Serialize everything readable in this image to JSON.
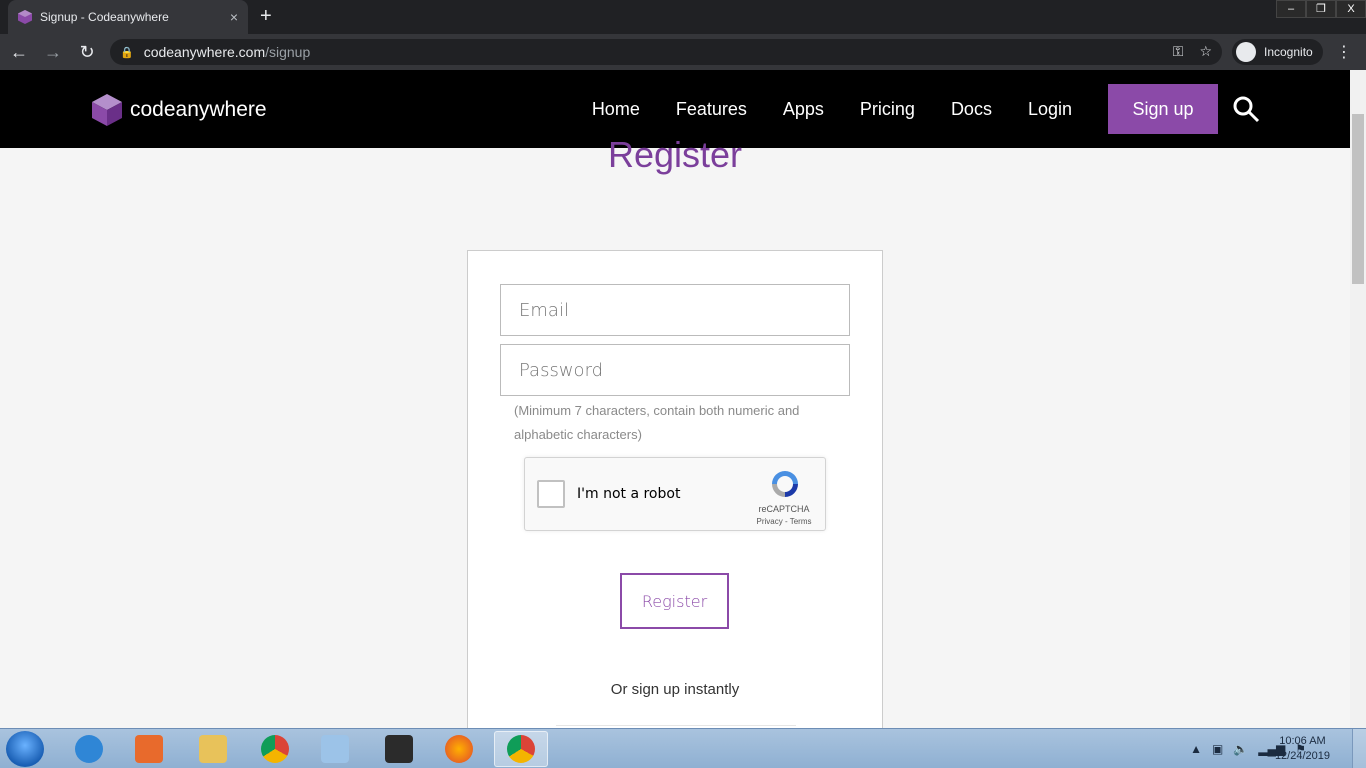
{
  "browser": {
    "tab_title": "Signup - Codeanywhere",
    "tab_close": "×",
    "new_tab": "+",
    "window_controls": [
      "–",
      "❐",
      "X"
    ],
    "url_host": "codeanywhere.com",
    "url_path": "/signup",
    "incognito_label": "Incognito",
    "back": "←",
    "forward": "→",
    "reload": "↻",
    "menu": "⋮"
  },
  "site": {
    "logo_text": "codeanywhere",
    "nav": [
      "Home",
      "Features",
      "Apps",
      "Pricing",
      "Docs",
      "Login"
    ],
    "signup_label": "Sign up",
    "accent": "#8b4aa8"
  },
  "form": {
    "title": "Register",
    "email_placeholder": "Email",
    "password_placeholder": "Password",
    "hint": "(Minimum 7 characters, contain both numeric and alphabetic characters)",
    "captcha_label": "I'm not a robot",
    "captcha_brand": "reCAPTCHA",
    "captcha_links": "Privacy - Terms",
    "register_label": "Register",
    "or_text": "Or sign up instantly"
  },
  "taskbar": {
    "items": [
      "internet-explorer-icon",
      "media-player-icon",
      "file-explorer-icon",
      "chrome-icon",
      "notepad-icon",
      "nox-icon",
      "firefox-icon",
      "chrome-icon"
    ],
    "time": "10:06 AM",
    "date": "12/24/2019"
  }
}
